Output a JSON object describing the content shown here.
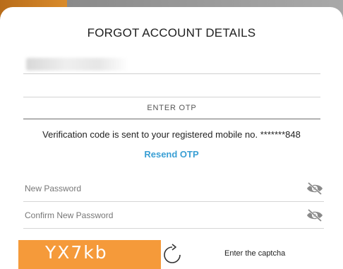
{
  "modal": {
    "title": "FORGOT ACCOUNT DETAILS"
  },
  "otp": {
    "label": "ENTER OTP"
  },
  "verification": {
    "message": "Verification code is sent to your registered mobile no. *******848",
    "resend_label": "Resend OTP"
  },
  "password": {
    "new_placeholder": "New Password",
    "confirm_placeholder": "Confirm New Password",
    "toggle_icon": "eye-slash-icon"
  },
  "captcha": {
    "code": "YX7kb",
    "label": "Enter the captcha",
    "refresh_icon": "refresh-icon"
  },
  "colors": {
    "accent_link": "#3a9fd4",
    "captcha_bg": "#f59a3a"
  }
}
